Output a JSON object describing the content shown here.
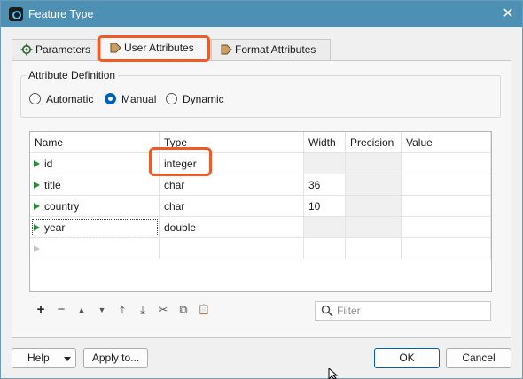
{
  "window": {
    "title": "Feature Type",
    "close_glyph": "✕"
  },
  "tabs": [
    {
      "label": "Parameters",
      "icon": "gear-icon"
    },
    {
      "label": "User Attributes",
      "icon": "attribute-arrow-icon",
      "active": true
    },
    {
      "label": "Format Attributes",
      "icon": "attribute-arrow-icon"
    }
  ],
  "attribute_definition": {
    "title": "Attribute Definition",
    "options": [
      "Automatic",
      "Manual",
      "Dynamic"
    ],
    "selected": "Manual"
  },
  "table": {
    "headers": [
      "Name",
      "Type",
      "Width",
      "Precision",
      "Value"
    ],
    "rows": [
      {
        "name": "id",
        "type": "integer",
        "width": "",
        "precision": "",
        "value": ""
      },
      {
        "name": "title",
        "type": "char",
        "width": "36",
        "precision": "",
        "value": ""
      },
      {
        "name": "country",
        "type": "char",
        "width": "10",
        "precision": "",
        "value": ""
      },
      {
        "name": "year",
        "type": "double",
        "width": "",
        "precision": "",
        "value": ""
      }
    ]
  },
  "toolbar": {
    "icons": [
      "add-icon",
      "remove-icon",
      "move-up-icon",
      "move-down-icon",
      "move-top-icon",
      "move-bottom-icon",
      "cut-icon",
      "copy-icon",
      "paste-icon"
    ],
    "glyphs": [
      "+",
      "−",
      "▲",
      "▼",
      "⤒",
      "⤓",
      "✂",
      "⧉",
      "📋"
    ],
    "filter_placeholder": "Filter"
  },
  "buttons": {
    "help": "Help",
    "apply": "Apply to...",
    "ok": "OK",
    "cancel": "Cancel"
  },
  "colors": {
    "titlebar": "#4e90b3",
    "highlight": "#ef5a26",
    "accent": "#005fb8"
  }
}
